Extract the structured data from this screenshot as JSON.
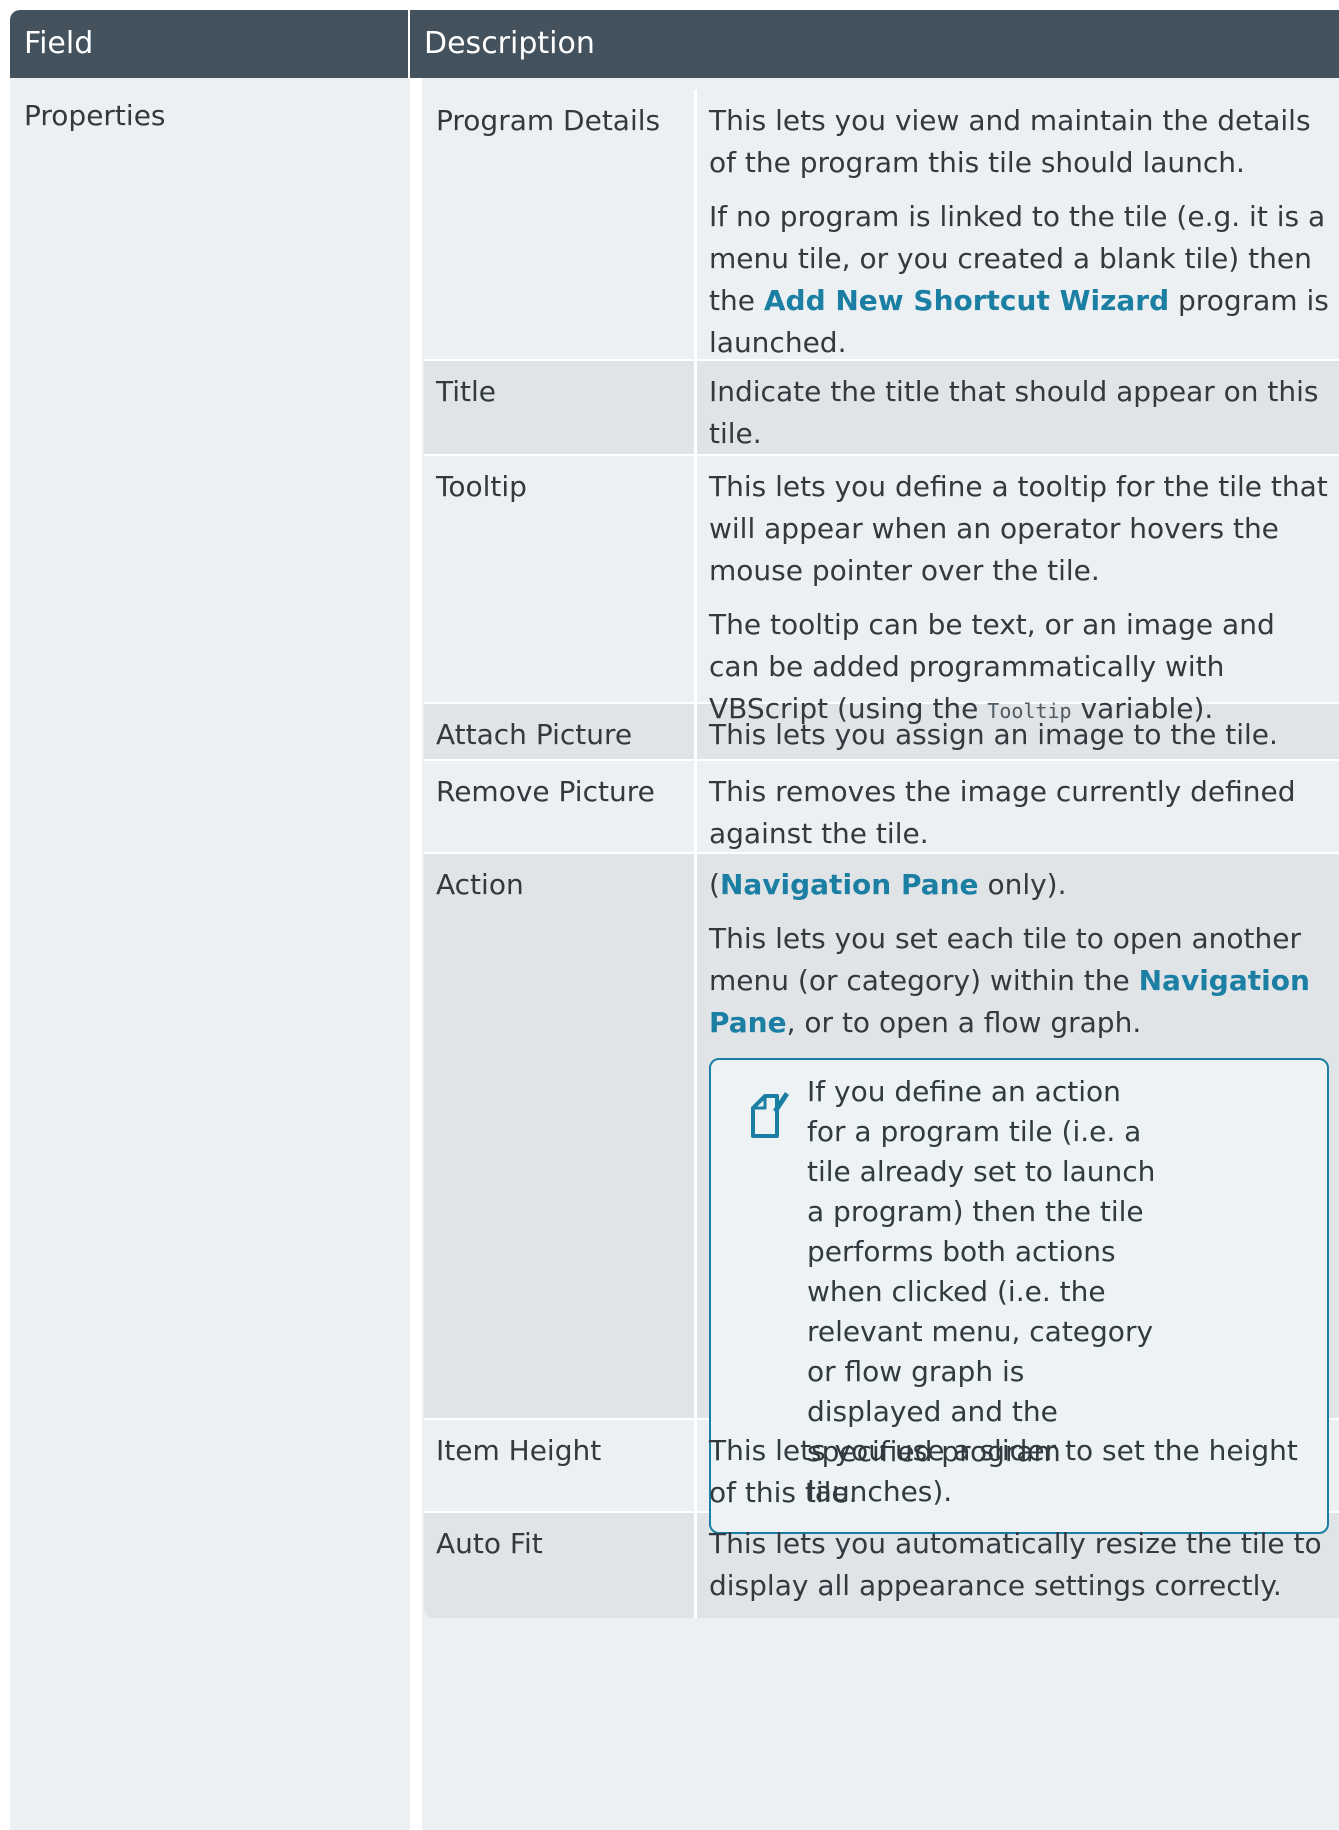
{
  "header": {
    "field_label": "Field",
    "description_label": "Description"
  },
  "field": "Properties",
  "rows": [
    {
      "name": "Program Details",
      "paragraphs": [
        "This lets you view and maintain the details of  the program this tile should launch."
      ],
      "para2_prefix": "If no program is linked to the tile (e.g. it is a menu tile, or you created a blank tile) then the ",
      "para2_link": "Add New Shortcut Wizard",
      "para2_suffix": " program is launched."
    },
    {
      "name": "Title",
      "text": "Indicate the title that should appear on this tile."
    },
    {
      "name": "Tooltip",
      "text": "This lets you define a tooltip for the tile that will appear when an operator hovers the mouse pointer over the tile.",
      "para2_prefix": "The tooltip can be text, or an image and can be added programmatically with VBScript (using the ",
      "para2_code": "Tooltip",
      "para2_suffix": " variable)."
    },
    {
      "name": "Attach Picture",
      "text": "This lets you assign an image to the tile."
    },
    {
      "name": "Remove Picture",
      "text": "This removes the image currently defined against the tile."
    },
    {
      "name": "Action",
      "para1_prefix": "(",
      "para1_link": "Navigation Pane",
      "para1_suffix": " only).",
      "para2_prefix": "This lets you set each tile to open another menu (or category) within the ",
      "para2_link": "Navigation Pane",
      "para2_suffix": ", or to open a flow graph.",
      "note": "If you define an action for a program tile (i.e. a tile already set to launch a program) then the tile performs both actions when clicked (i.e. the relevant menu, category or flow graph is displayed and the specified program launches).",
      "note_icon": "note-edit-icon"
    },
    {
      "name": "Item Height",
      "text": "This lets you use a slider to set the height of this tile."
    },
    {
      "name": "Auto Fit",
      "text": "This lets you automatically resize the tile to display all appearance settings correctly."
    }
  ],
  "colors": {
    "header_bg": "#44525e",
    "link": "#1b7fa3",
    "row_light": "#edf0f2",
    "row_dark": "#e0e4e7"
  }
}
